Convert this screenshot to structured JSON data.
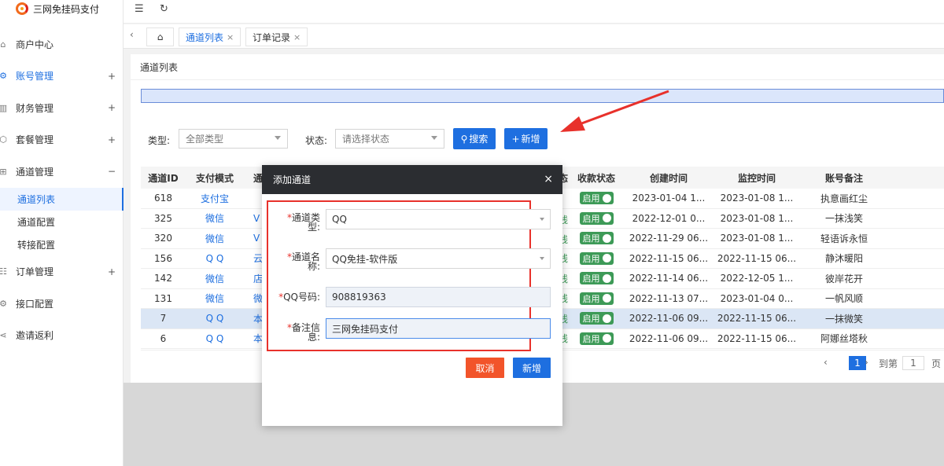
{
  "app": {
    "title": "三网免挂码支付"
  },
  "sidebar": {
    "items": [
      {
        "label": "商户中心",
        "icon": "home-icon",
        "toggle": ""
      },
      {
        "label": "账号管理",
        "icon": "gear-icon",
        "toggle": "+"
      },
      {
        "label": "财务管理",
        "icon": "chart-icon",
        "toggle": "+"
      },
      {
        "label": "套餐管理",
        "icon": "package-icon",
        "toggle": "+"
      },
      {
        "label": "通道管理",
        "icon": "grid-icon",
        "toggle": "−"
      },
      {
        "label": "订单管理",
        "icon": "list-icon",
        "toggle": "+"
      },
      {
        "label": "接口配置",
        "icon": "gear-icon",
        "toggle": ""
      },
      {
        "label": "邀请返利",
        "icon": "share-icon",
        "toggle": ""
      }
    ],
    "subitems": [
      {
        "label": "通道列表"
      },
      {
        "label": "通道配置"
      },
      {
        "label": "转接配置"
      }
    ]
  },
  "topbar": {
    "menu_icon": "☰",
    "refresh_icon": "↻"
  },
  "tabs": [
    {
      "label": "通道列表",
      "close": "×"
    },
    {
      "label": "订单记录",
      "close": "×"
    }
  ],
  "page": {
    "title": "通道列表"
  },
  "filters": {
    "type_label": "类型:",
    "type_value": "全部类型",
    "status_label": "状态:",
    "status_value": "请选择状态",
    "search_label": "搜索",
    "add_label": "新增"
  },
  "table": {
    "headers": {
      "id": "通道ID",
      "mode": "支付模式",
      "name": "通",
      "status_partial": "状态",
      "switch": "收款状态",
      "created": "创建时间",
      "monitor": "监控时间",
      "note": "账号备注"
    },
    "enabled_label": "启用",
    "rows": [
      {
        "id": "618",
        "mode": "支付宝",
        "name": "",
        "created": "2023-01-04 1...",
        "monitor": "2023-01-08 1...",
        "note": "执意画红尘",
        "status_tail": ""
      },
      {
        "id": "325",
        "mode": "微信",
        "name": "V",
        "created": "2022-12-01 0...",
        "monitor": "2023-01-08 1...",
        "note": "一抹浅笑",
        "status_tail": "线"
      },
      {
        "id": "320",
        "mode": "微信",
        "name": "V",
        "created": "2022-11-29 06...",
        "monitor": "2023-01-08 1...",
        "note": "轻语诉永恒",
        "status_tail": "线"
      },
      {
        "id": "156",
        "mode": "Q Q",
        "name": "云",
        "created": "2022-11-15 06...",
        "monitor": "2022-11-15 06...",
        "note": "静沐暖阳",
        "status_tail": "线"
      },
      {
        "id": "142",
        "mode": "微信",
        "name": "店",
        "created": "2022-11-14 06...",
        "monitor": "2022-12-05 1...",
        "note": "彼岸花开",
        "status_tail": "线"
      },
      {
        "id": "131",
        "mode": "微信",
        "name": "微",
        "created": "2022-11-13 07...",
        "monitor": "2023-01-04 0...",
        "note": "一帆风顺",
        "status_tail": "线"
      },
      {
        "id": "7",
        "mode": "Q Q",
        "name": "本",
        "created": "2022-11-06 09...",
        "monitor": "2022-11-15 06...",
        "note": "一抹微笑",
        "status_tail": "线"
      },
      {
        "id": "6",
        "mode": "Q Q",
        "name": "本",
        "created": "2022-11-06 09...",
        "monitor": "2022-11-15 06...",
        "note": "阿娜丝塔秋",
        "status_tail": "线"
      }
    ]
  },
  "pagination": {
    "prev": "‹",
    "current": "1",
    "next": "›",
    "goto_label": "到第",
    "goto_value": "1",
    "page_suffix": "页"
  },
  "modal": {
    "title": "添加通道",
    "close": "×",
    "fields": [
      {
        "required": "*",
        "label_line1": "通道类",
        "label_line2": "型:",
        "value": "QQ"
      },
      {
        "required": "*",
        "label_line1": "通道名",
        "label_line2": "称:",
        "value": "QQ免挂-软件版"
      },
      {
        "required": "*",
        "label_line1": "QQ号码:",
        "label_line2": "",
        "value": "908819363"
      },
      {
        "required": "*",
        "label_line1": "备注信",
        "label_line2": "息:",
        "value": "三网免挂码支付"
      }
    ],
    "cancel_label": "取消",
    "submit_label": "新增"
  },
  "colors": {
    "primary": "#1e6fe0",
    "danger": "#f2542a",
    "success": "#3d9a57",
    "highlight_frame": "#e8312b",
    "modal_header": "#2b2d31"
  }
}
